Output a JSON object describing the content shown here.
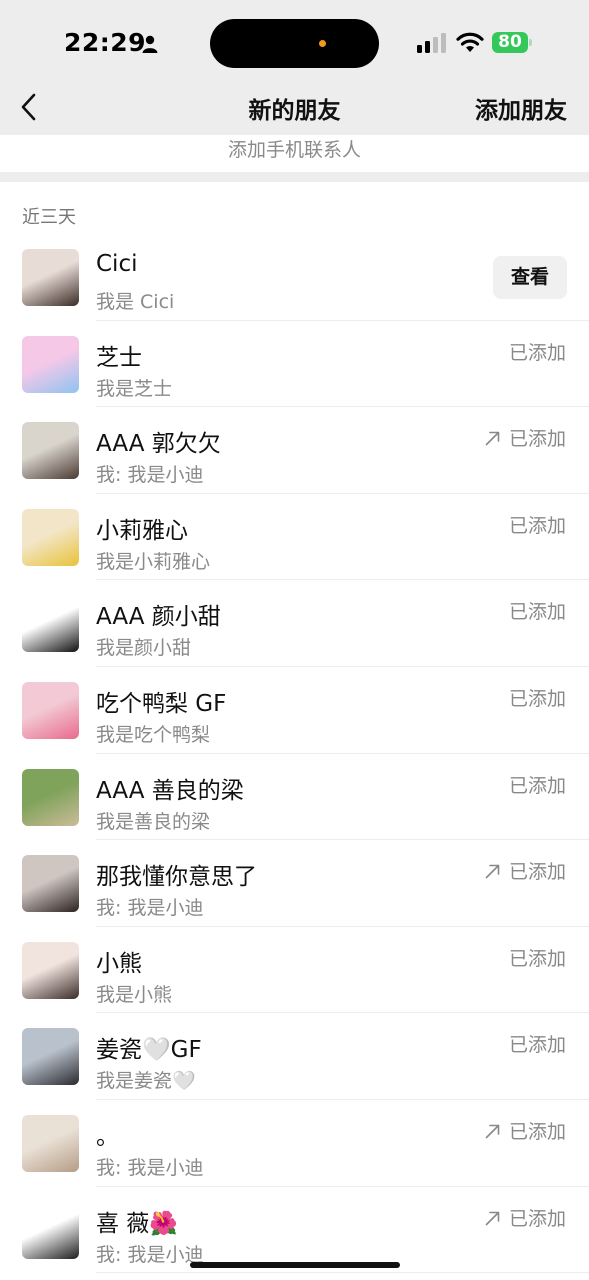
{
  "status_bar": {
    "time": "22:29",
    "battery": "80"
  },
  "nav": {
    "title": "新的朋友",
    "action": "添加朋友"
  },
  "phone_contacts": "添加手机联系人",
  "section_header": "近三天",
  "view_label": "查看",
  "colors": {
    "accent_battery": "#34c759",
    "island_dot": "#f39a1a",
    "background_gray": "#ededed"
  },
  "friends": [
    {
      "name": "Cici",
      "subtitle": "我是 Cici",
      "status": "",
      "action": "view",
      "avatar_colors": [
        "#e8dcd6",
        "#3b2a25"
      ]
    },
    {
      "name": "芝士",
      "subtitle": "我是芝士",
      "status": "已添加",
      "arrow": false,
      "avatar_colors": [
        "#f6c8e8",
        "#8fc3f0"
      ]
    },
    {
      "name": "AAA 郭欠欠",
      "subtitle": "我: 我是小迪",
      "status": "已添加",
      "arrow": true,
      "avatar_colors": [
        "#d9d4cc",
        "#4a3a33"
      ]
    },
    {
      "name": "小莉雅心",
      "subtitle": "我是小莉雅心",
      "status": "已添加",
      "arrow": false,
      "avatar_colors": [
        "#f3e6c8",
        "#e8c23a"
      ]
    },
    {
      "name": "AAA 颜小甜",
      "subtitle": "我是颜小甜",
      "status": "已添加",
      "arrow": false,
      "avatar_colors": [
        "#ffffff",
        "#111111"
      ]
    },
    {
      "name": "吃个鸭梨 GF",
      "subtitle": "我是吃个鸭梨",
      "status": "已添加",
      "arrow": false,
      "avatar_colors": [
        "#f2c9d4",
        "#e86a8a"
      ]
    },
    {
      "name": "AAA 善良的梁",
      "subtitle": "我是善良的梁",
      "status": "已添加",
      "arrow": false,
      "avatar_colors": [
        "#7fa35a",
        "#cdbb9a"
      ]
    },
    {
      "name": "那我懂你意思了",
      "subtitle": "我: 我是小迪",
      "status": "已添加",
      "arrow": true,
      "avatar_colors": [
        "#cfc6c2",
        "#2b2220"
      ]
    },
    {
      "name": "小熊",
      "subtitle": "我是小熊",
      "status": "已添加",
      "arrow": false,
      "avatar_colors": [
        "#f1e4df",
        "#3a2b27"
      ]
    },
    {
      "name": "姜瓷🤍GF",
      "subtitle": "我是姜瓷🤍",
      "status": "已添加",
      "arrow": false,
      "avatar_colors": [
        "#b9c2cc",
        "#2a2a30"
      ]
    },
    {
      "name": "。",
      "subtitle": "我: 我是小迪",
      "status": "已添加",
      "arrow": true,
      "avatar_colors": [
        "#eae1d6",
        "#b59c86"
      ]
    },
    {
      "name": "喜 薇🌺",
      "subtitle": "我: 我是小迪",
      "status": "已添加",
      "arrow": true,
      "avatar_colors": [
        "#ffffff",
        "#1c1c1c"
      ]
    }
  ]
}
